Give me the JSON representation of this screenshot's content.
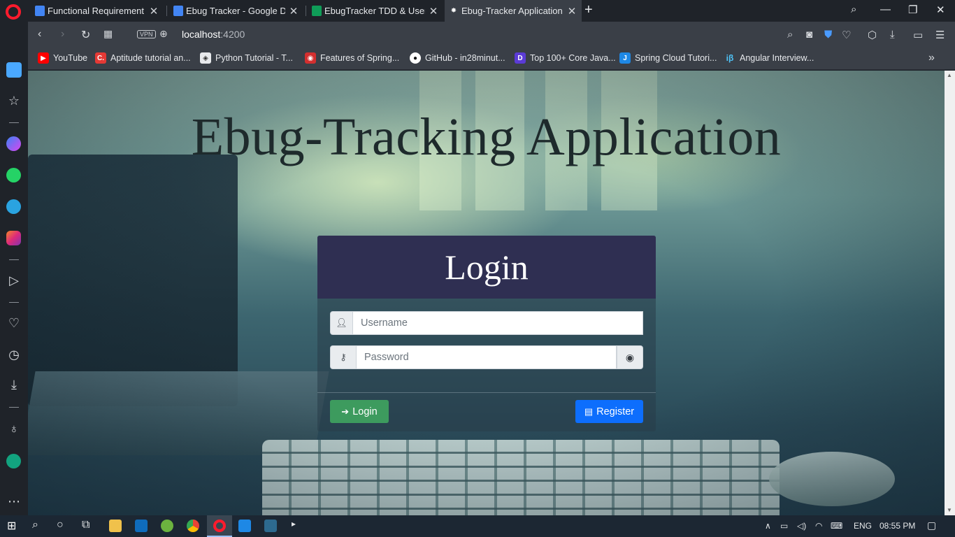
{
  "browser": {
    "tabs": [
      {
        "title": "Functional Requirement - G",
        "favicon_color": "#4285f4"
      },
      {
        "title": "Ebug Tracker - Google Doc",
        "favicon_color": "#4285f4"
      },
      {
        "title": "EbugTracker TDD & UserSto",
        "favicon_color": "#0f9d58"
      },
      {
        "title": "Ebug-Tracker Application",
        "favicon_color": "#ffffff",
        "active": true
      }
    ],
    "address": {
      "host": "localhost",
      "port": ":4200",
      "vpn_label": "VPN"
    },
    "bookmarks": [
      {
        "label": "YouTube",
        "icon": "youtube-icon",
        "color": "#ff0000",
        "glyph": "▶"
      },
      {
        "label": "Aptitude tutorial an...",
        "icon": "c-icon",
        "color": "#e53935",
        "glyph": "C."
      },
      {
        "label": "Python Tutorial - T...",
        "icon": "python-tutorial-icon",
        "color": "#e7e9ec",
        "glyph": "◈"
      },
      {
        "label": "Features of Spring...",
        "icon": "spring-features-icon",
        "color": "#d32f2f",
        "glyph": "◉"
      },
      {
        "label": "GitHub - in28minut...",
        "icon": "github-icon",
        "color": "#ffffff",
        "glyph": "●"
      },
      {
        "label": "Top 100+ Core Java...",
        "icon": "java-icon",
        "color": "#5b3bd6",
        "glyph": "D"
      },
      {
        "label": "Spring Cloud Tutori...",
        "icon": "javadevjournal-icon",
        "color": "#1e88e5",
        "glyph": "J"
      },
      {
        "label": "Angular Interview...",
        "icon": "angular-interview-icon",
        "color": "#4fc3f7",
        "glyph": "iβ"
      }
    ]
  },
  "page": {
    "app_title": "Ebug-Tracking Application",
    "login": {
      "heading": "Login",
      "username_placeholder": "Username",
      "password_placeholder": "Password",
      "login_button": "Login",
      "register_button": "Register"
    }
  },
  "taskbar": {
    "language": "ENG",
    "time": "08:55 PM"
  }
}
